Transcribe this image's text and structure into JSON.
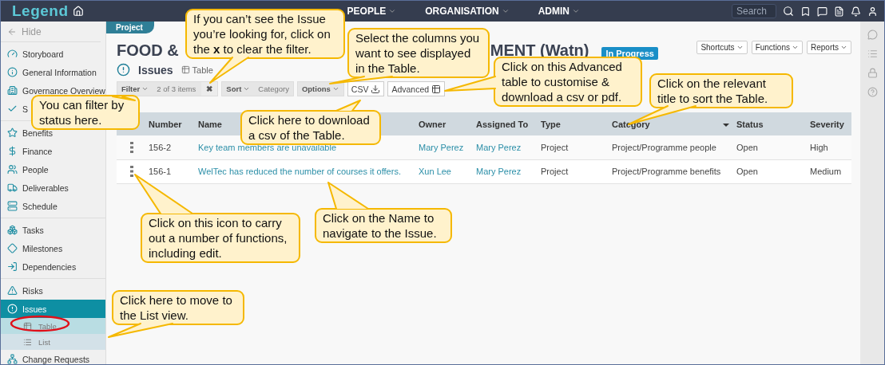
{
  "topbar": {
    "logo": "Legend",
    "nav": [
      {
        "label": "PEOPLE"
      },
      {
        "label": "ORGANISATION"
      },
      {
        "label": "ADMIN"
      }
    ],
    "search": {
      "placeholder": "Search"
    }
  },
  "sidebar": {
    "hide": "Hide",
    "groups": [
      [
        {
          "label": "Storyboard",
          "selected": false
        },
        {
          "label": "General Information",
          "selected": false
        },
        {
          "label": "Governance Overview",
          "selected": false
        },
        {
          "label": "S",
          "selected": false
        }
      ],
      [
        {
          "label": "Benefits",
          "selected": false
        },
        {
          "label": "Finance",
          "selected": false
        },
        {
          "label": "People",
          "selected": false
        },
        {
          "label": "Deliverables",
          "selected": false
        },
        {
          "label": "Schedule",
          "selected": false
        }
      ],
      [
        {
          "label": "Tasks",
          "selected": false
        },
        {
          "label": "Milestones",
          "selected": false
        },
        {
          "label": "Dependencies",
          "selected": false
        }
      ],
      [
        {
          "label": "Risks",
          "selected": false
        },
        {
          "label": "Issues",
          "selected": true,
          "children": [
            {
              "label": "Table",
              "selected": true
            },
            {
              "label": "List",
              "selected": false
            }
          ]
        },
        {
          "label": "Change Requests",
          "selected": false
        }
      ]
    ]
  },
  "header": {
    "tag": "Project",
    "title_parts": [
      "FOOD &",
      "MENT (Watn)"
    ],
    "status": "In Progress",
    "buttons": [
      "Shortcuts",
      "Functions",
      "Reports"
    ],
    "section": "Issues",
    "view": "Table"
  },
  "toolbar": {
    "filter": "Filter",
    "filter_count": "2 of 3 items",
    "clear": "✖",
    "sort": "Sort",
    "sort_field": "Category",
    "options": "Options",
    "csv": "CSV",
    "advanced": "Advanced"
  },
  "table": {
    "columns": [
      {
        "label": "Number",
        "sorted": false
      },
      {
        "label": "Name",
        "sorted": false
      },
      {
        "label": "Owner",
        "sorted": false
      },
      {
        "label": "Assigned To",
        "sorted": false
      },
      {
        "label": "Type",
        "sorted": false
      },
      {
        "label": "Category",
        "sorted": true
      },
      {
        "label": "Status",
        "sorted": false
      },
      {
        "label": "Severity",
        "sorted": false
      }
    ],
    "rows": [
      [
        "156-2",
        "Key team members are unavailable",
        "Mary Perez",
        "Mary Perez",
        "Project",
        "Project/Programme people",
        "Open",
        "High"
      ],
      [
        "156-1",
        "WelTec has reduced the number of courses it offers.",
        "Xun Lee",
        "Mary Perez",
        "Project",
        "Project/Programme benefits",
        "Open",
        "Medium"
      ]
    ]
  },
  "callouts": [
    "If you can’t see the Issue you’re looking for, click on the **x** to clear the filter.",
    "Select the columns you want to see displayed in the Table.",
    "Click on this Advanced table to customise & download a csv or pdf.",
    "Click on the relevant title to sort the Table.",
    "You can filter by status here.",
    "Click here to download a csv of the Table.",
    "Click on this icon to carry out a number of functions, including edit.",
    "Click on the Name to navigate to the Issue.",
    "Click here to move to the List view."
  ]
}
